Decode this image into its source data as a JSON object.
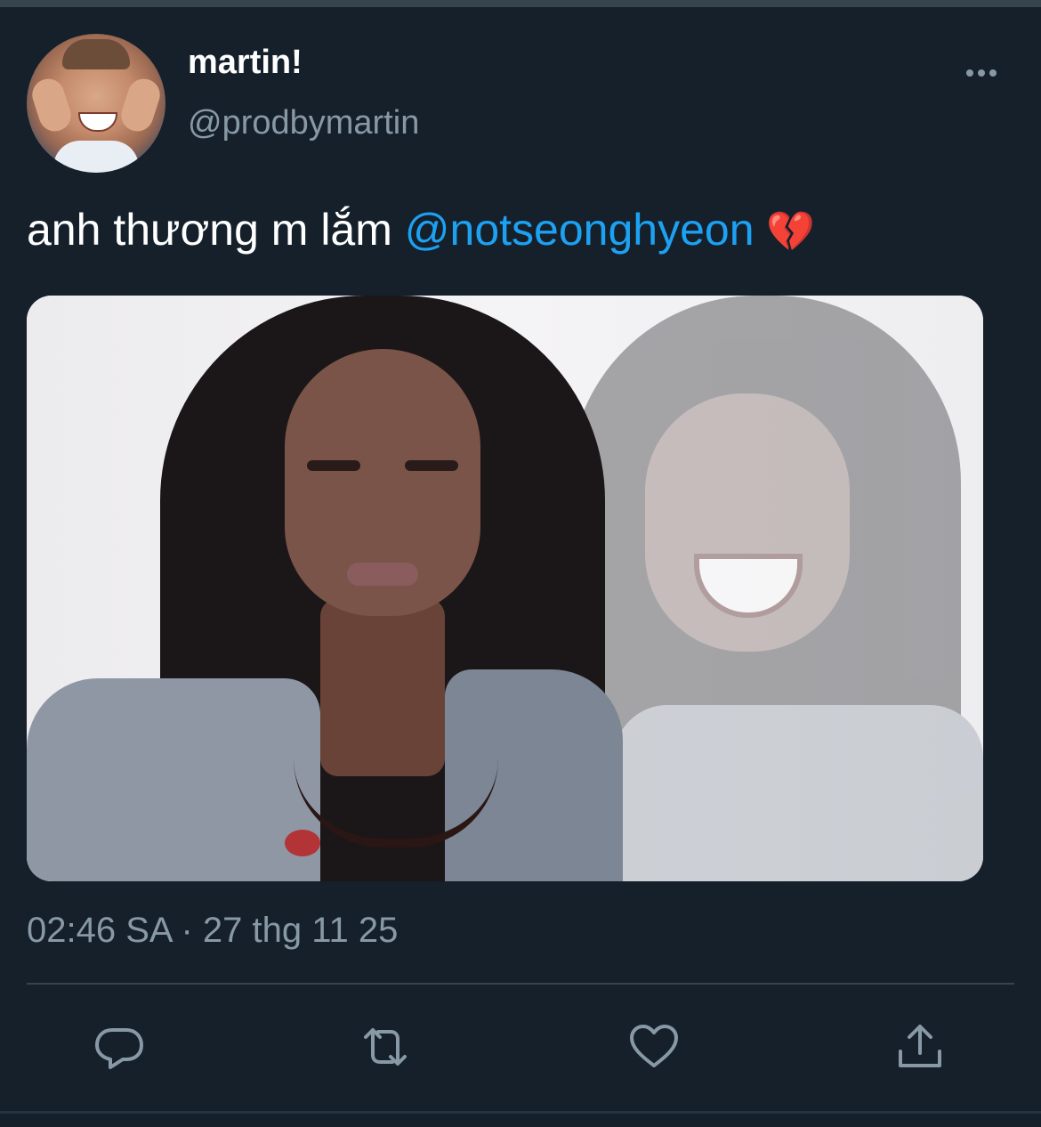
{
  "tweet": {
    "display_name": "martin!",
    "handle": "@prodbymartin",
    "text_before": "anh thương m lắm ",
    "mention": "@notseonghyeon",
    "emoji": "💔",
    "timestamp": "02:46 SA · 27 thg 11 25"
  },
  "icons": {
    "more": "more-horizontal-icon",
    "reply": "reply-icon",
    "retweet": "retweet-icon",
    "like": "heart-icon",
    "share": "share-icon"
  },
  "colors": {
    "background": "#15202b",
    "secondary_text": "#8899a6",
    "link": "#1da1f2",
    "divider": "#38444d"
  }
}
